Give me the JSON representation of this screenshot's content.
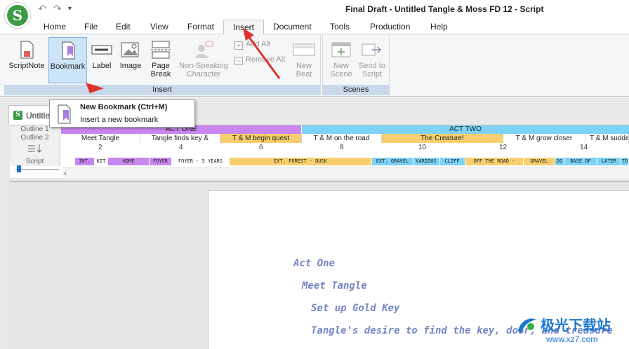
{
  "window": {
    "title": "Final Draft - Untitled Tangle & Moss FD 12 - Script"
  },
  "app_logo": {
    "glyph": "S"
  },
  "quick_access": {
    "undo": "↶",
    "redo": "↷",
    "more": "▾"
  },
  "tabs": [
    {
      "label": "Home"
    },
    {
      "label": "File"
    },
    {
      "label": "Edit"
    },
    {
      "label": "View"
    },
    {
      "label": "Format"
    },
    {
      "label": "Insert",
      "active": true
    },
    {
      "label": "Document"
    },
    {
      "label": "Tools"
    },
    {
      "label": "Production"
    },
    {
      "label": "Help"
    }
  ],
  "ribbon": {
    "insert_group": {
      "label": "Insert",
      "buttons": {
        "scriptnote": "ScriptNote",
        "bookmark": "Bookmark",
        "label": "Label",
        "image": "Image",
        "page_break_1": "Page",
        "page_break_2": "Break",
        "nonspeaking_1": "Non-Speaking",
        "nonspeaking_2": "Character",
        "add_alt": "Add Alt",
        "remove_alt": "Remove Alt",
        "new_beat_1": "New",
        "new_beat_2": "Beat"
      }
    },
    "scenes_group": {
      "label": "Scenes",
      "buttons": {
        "new_scene_1": "New",
        "new_scene_2": "Scene",
        "send_script_1": "Send to",
        "send_script_2": "Script"
      }
    }
  },
  "tooltip": {
    "title": "New Bookmark (Ctrl+M)",
    "description": "Insert a new bookmark"
  },
  "document_tab": {
    "label": "Untitle"
  },
  "navigator": {
    "row_labels": {
      "outline1": "Outline 1",
      "outline2": "Outline 2",
      "script": "Script"
    },
    "outline1": [
      {
        "label": "ACT ONE",
        "color": "#c986f0"
      },
      {
        "label": "ACT TWO",
        "color": "#7cd3f5"
      }
    ],
    "outline2": [
      {
        "label": "Meet Tangle",
        "color": "#ffffff"
      },
      {
        "label": "Tangle finds key &",
        "color": "#ffffff"
      },
      {
        "label": "T & M begin quest",
        "color": "#f8cf6e"
      },
      {
        "label": "T & M on the road",
        "color": "#ffffff"
      },
      {
        "label": "The Creature!",
        "color": "#f8cf6e"
      },
      {
        "label": "T & M grow closer",
        "color": "#ffffff"
      },
      {
        "label": "T & M sudde",
        "color": "#ffffff"
      }
    ],
    "ticks": [
      "2",
      "4",
      "6",
      "8",
      "10",
      "12",
      "14"
    ],
    "scenes": [
      {
        "label": "INT.",
        "color": "#c986f0"
      },
      {
        "label": "KIT",
        "color": "#ffffff"
      },
      {
        "label": "HOME",
        "color": "#c986f0"
      },
      {
        "label": "FOYER",
        "color": "#c986f0"
      },
      {
        "label": "FOYER - 5 YEARS",
        "color": "#ffffff"
      },
      {
        "label": "EXT. FOREST - DUSK",
        "color": "#f8cf6e"
      },
      {
        "label": "EXT. GRAVEL",
        "color": "#7cd3f5"
      },
      {
        "label": "VARIOUS",
        "color": "#7cd3f5"
      },
      {
        "label": "CLIFF",
        "color": "#7cd3f5"
      },
      {
        "label": "OFF THE ROAD -",
        "color": "#f8cf6e"
      },
      {
        "label": "GRAVEL",
        "color": "#f8cf6e"
      },
      {
        "label": "DO",
        "color": "#7cd3f5"
      },
      {
        "label": "BASE OF",
        "color": "#7cd3f5"
      },
      {
        "label": "LATER",
        "color": "#7cd3f5"
      },
      {
        "label": "TO",
        "color": "#7cd3f5"
      }
    ],
    "scroll_left": "‹"
  },
  "script_lines": [
    "Act One",
    "Meet Tangle",
    "Set up Gold Key",
    "Tangle's desire to find the key, door, and treasure"
  ],
  "watermark": {
    "main": "极光下载站",
    "sub": "www.xz7.com"
  },
  "colors": {
    "accent": "#1e6fd4",
    "annotation_arrow": "#e0302b",
    "script_text": "#7785c4",
    "ribbon_group_label": "#c7d9ea"
  }
}
